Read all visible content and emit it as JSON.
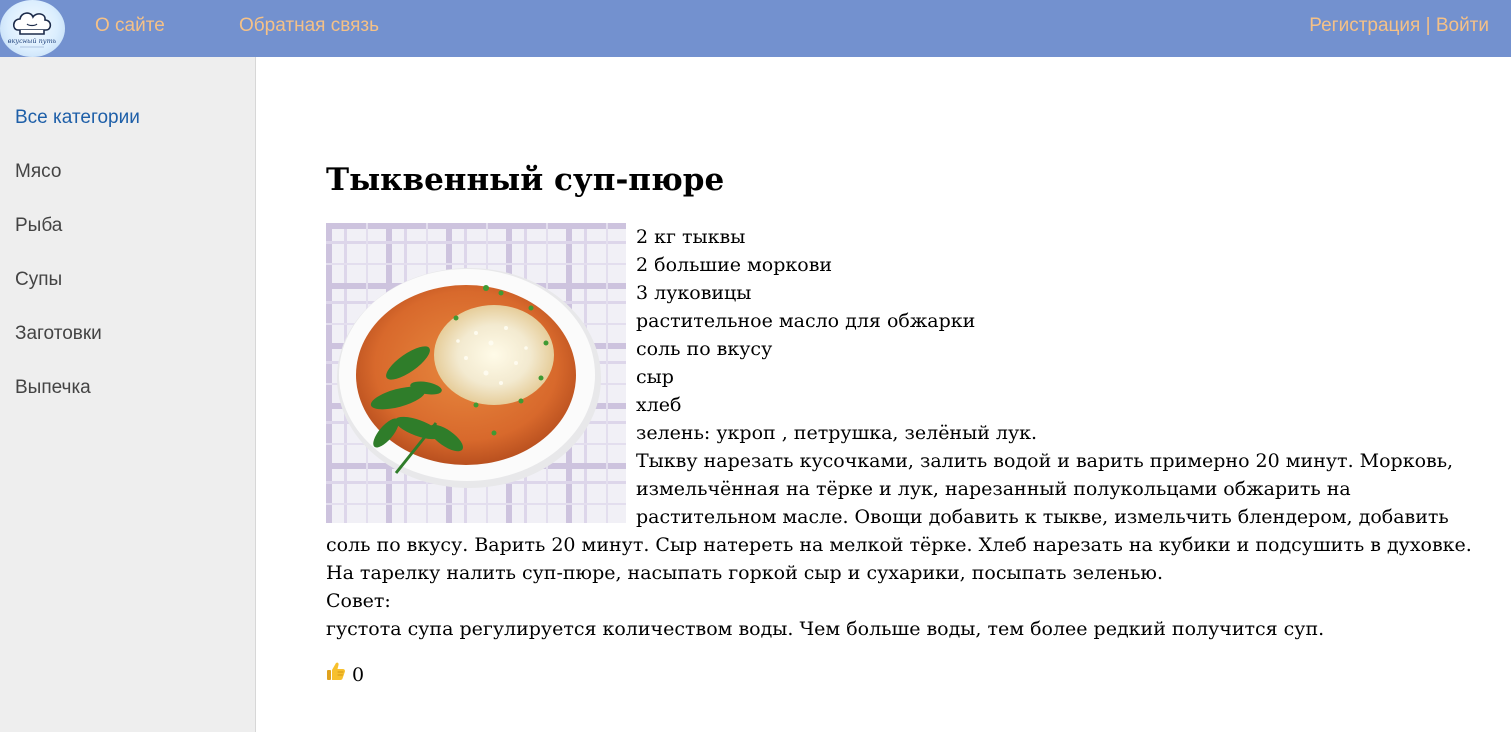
{
  "header": {
    "logo_text": "вкусный путь",
    "nav": [
      {
        "label": "О сайте"
      },
      {
        "label": "Обратная связь"
      }
    ],
    "register_label": "Регистрация",
    "separator": " | ",
    "login_label": "Войти"
  },
  "sidebar": {
    "categories": [
      {
        "label": "Все категории",
        "active": true
      },
      {
        "label": "Мясо",
        "active": false
      },
      {
        "label": "Рыба",
        "active": false
      },
      {
        "label": "Супы",
        "active": false
      },
      {
        "label": "Заготовки",
        "active": false
      },
      {
        "label": "Выпечка",
        "active": false
      }
    ]
  },
  "recipe": {
    "title": "Тыквенный суп-пюре",
    "ingredients": [
      "2 кг тыквы",
      "2 большие моркови",
      "3 луковицы",
      "растительное масло для обжарки",
      "соль по вкусу",
      "сыр",
      "хлеб",
      "зелень: укроп , петрушка, зелёный лук."
    ],
    "instructions": "Тыкву нарезать кусочками, залить водой и варить примерно 20 минут. Морковь, измельчённая на тёрке и лук, нарезанный полукольцами обжарить на растительном масле. Овощи добавить к тыкве, измельчить блендером, добавить соль по вкусу. Варить 20 минут. Сыр натереть на мелкой тёрке. Хлеб нарезать на кубики и подсушить в духовке.",
    "serving": "На тарелку налить суп-пюре, насыпать горкой сыр и сухарики, посыпать зеленью.",
    "tip_label": "Совет:",
    "tip": "густота супа регулируется количеством воды. Чем больше воды, тем более редкий получится суп.",
    "likes": "0"
  },
  "colors": {
    "header_bg": "#7391cf",
    "header_link": "#f5c187",
    "sidebar_bg": "#eeeeee",
    "active_category": "#1e5fa8"
  },
  "icons": {
    "logo": "chef-hat-icon",
    "like": "thumbs-up-icon"
  }
}
